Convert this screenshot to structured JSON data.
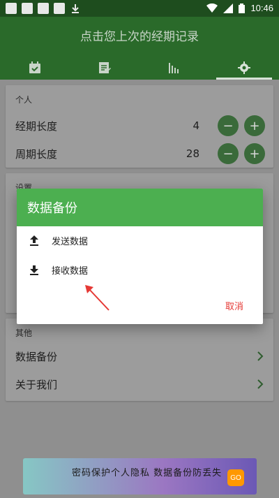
{
  "status_bar": {
    "time": "10:46"
  },
  "app": {
    "title": "点击您上次的经期记录"
  },
  "tabs": [
    {
      "icon": "calendar-icon"
    },
    {
      "icon": "note-icon"
    },
    {
      "icon": "bar-chart-icon"
    },
    {
      "icon": "gear-icon",
      "active": true
    }
  ],
  "personal": {
    "title": "个人",
    "rows": [
      {
        "label": "经期长度",
        "value": "4",
        "minus": "−",
        "plus": "+"
      },
      {
        "label": "周期长度",
        "value": "28",
        "minus": "−",
        "plus": "+"
      }
    ]
  },
  "settings": {
    "title": "设置"
  },
  "other": {
    "title": "其他",
    "items": [
      {
        "label": "数据备份"
      },
      {
        "label": "关于我们"
      }
    ]
  },
  "dialog": {
    "title": "数据备份",
    "items": [
      {
        "label": "发送数据",
        "icon": "upload-icon"
      },
      {
        "label": "接收数据",
        "icon": "download-icon"
      }
    ],
    "cancel": "取消"
  },
  "ad": {
    "text": "密码保护个人隐私 数据备份防丢失",
    "button": "GO"
  },
  "colors": {
    "header": "#2a6a2a",
    "dialog_header": "#4caf50",
    "cancel": "#e53935",
    "arrow": "#e53935"
  }
}
